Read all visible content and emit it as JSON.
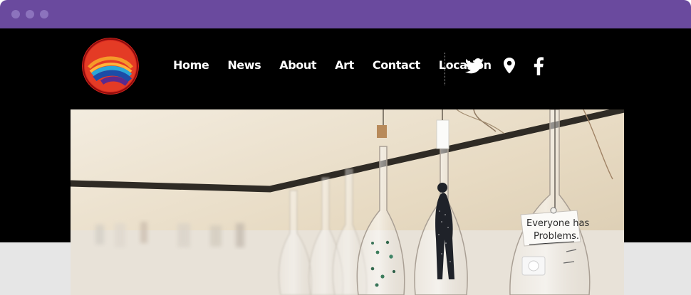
{
  "window": {
    "controls": [
      "close",
      "minimize",
      "zoom"
    ]
  },
  "header": {
    "logo_icon": "swirl-logo-icon",
    "nav": [
      {
        "label": "Home"
      },
      {
        "label": "News"
      },
      {
        "label": "About"
      },
      {
        "label": "Art"
      },
      {
        "label": "Contact"
      },
      {
        "label": "Location"
      }
    ],
    "social": [
      {
        "icon": "twitter-icon"
      },
      {
        "icon": "location-pin-icon"
      },
      {
        "icon": "facebook-icon"
      }
    ]
  },
  "hero": {
    "tag_line_1": "Everyone has",
    "tag_line_2": "Problems."
  },
  "colors": {
    "chrome": "#6a4a9e",
    "header_bg": "#000000",
    "bottom_band": "#e6e6e6",
    "nav_text": "#ffffff"
  }
}
